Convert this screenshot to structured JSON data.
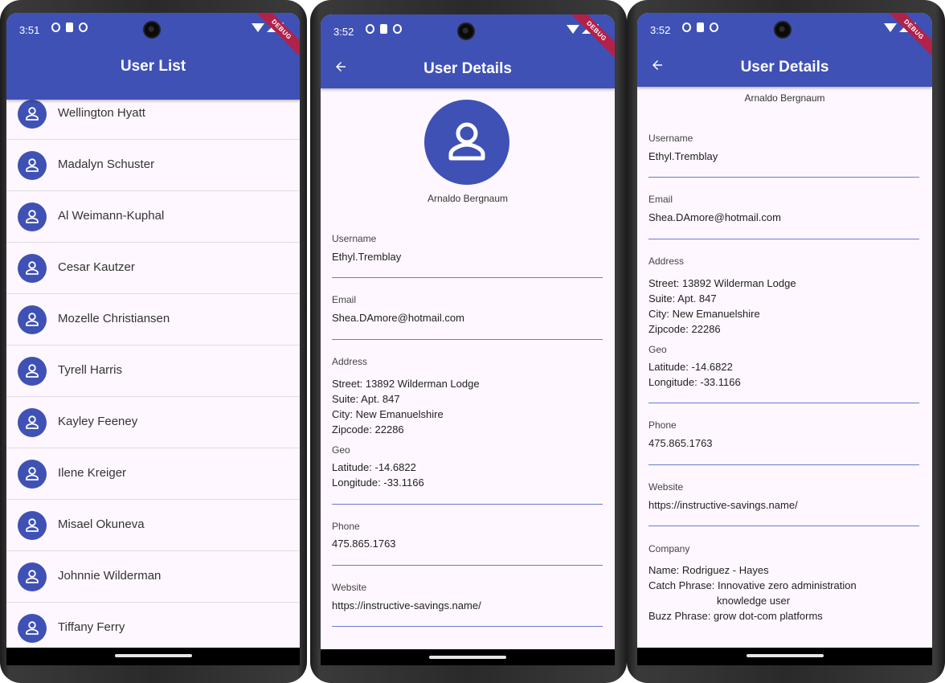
{
  "status_bar": {
    "time_1": "3:51",
    "time_2": "3:52",
    "time_3": "3:52",
    "debug_label": "DEBUG"
  },
  "screen_list": {
    "title": "User List",
    "users": [
      "Wellington Hyatt",
      "Madalyn Schuster",
      "Al Weimann-Kuphal",
      "Cesar Kautzer",
      "Mozelle Christiansen",
      "Tyrell Harris",
      "Kayley Feeney",
      "Ilene Kreiger",
      "Misael Okuneva",
      "Johnnie Wilderman",
      "Tiffany Ferry"
    ]
  },
  "screen_details": {
    "title": "User Details",
    "name": "Arnaldo Bergnaum",
    "username_label": "Username",
    "username": "Ethyl.Tremblay",
    "email_label": "Email",
    "email": "Shea.DAmore@hotmail.com",
    "address_label": "Address",
    "street_label": "Street:",
    "street": "13892 Wilderman Lodge",
    "suite_label": "Suite:",
    "suite": "Apt. 847",
    "city_label": "City:",
    "city": "New Emanuelshire",
    "zip_label": "Zipcode:",
    "zip": "22286",
    "geo_label": "Geo",
    "lat_label": "Latitude:",
    "lat": "-14.6822",
    "lng_label": "Longitude:",
    "lng": "-33.1166",
    "phone_label": "Phone",
    "phone": "475.865.1763",
    "website_label": "Website",
    "website": "https://instructive-savings.name/",
    "company_label": "Company",
    "company_name_label": "Name:",
    "company_name": "Rodriguez - Hayes",
    "catch_phrase_label": "Catch Phrase:",
    "catch_phrase_1": "Innovative zero administration",
    "catch_phrase_2": "knowledge user",
    "buzz_phrase_label": "Buzz Phrase:",
    "buzz_phrase": "grow dot-com platforms"
  },
  "colors": {
    "primary": "#3f51b5",
    "background": "#fef7ff",
    "divider": "#6a7bd1"
  },
  "icons": {
    "avatar": "person-outline-icon",
    "back": "arrow-back-icon"
  }
}
